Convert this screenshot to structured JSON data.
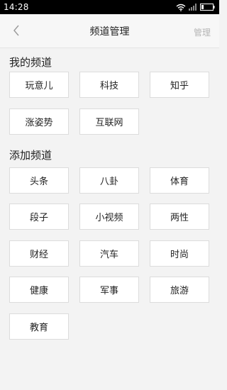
{
  "status_bar": {
    "time": "14:28"
  },
  "header": {
    "title": "频道管理",
    "back_icon": "chevron-left-icon",
    "manage_label": "管理"
  },
  "my_channels": {
    "title": "我的频道",
    "items": [
      "玩意儿",
      "科技",
      "知乎",
      "涨姿势",
      "互联网"
    ]
  },
  "add_channels": {
    "title": "添加频道",
    "items": [
      "头条",
      "八卦",
      "体育",
      "段子",
      "小视频",
      "两性",
      "财经",
      "汽车",
      "时尚",
      "健康",
      "军事",
      "旅游",
      "教育"
    ]
  }
}
